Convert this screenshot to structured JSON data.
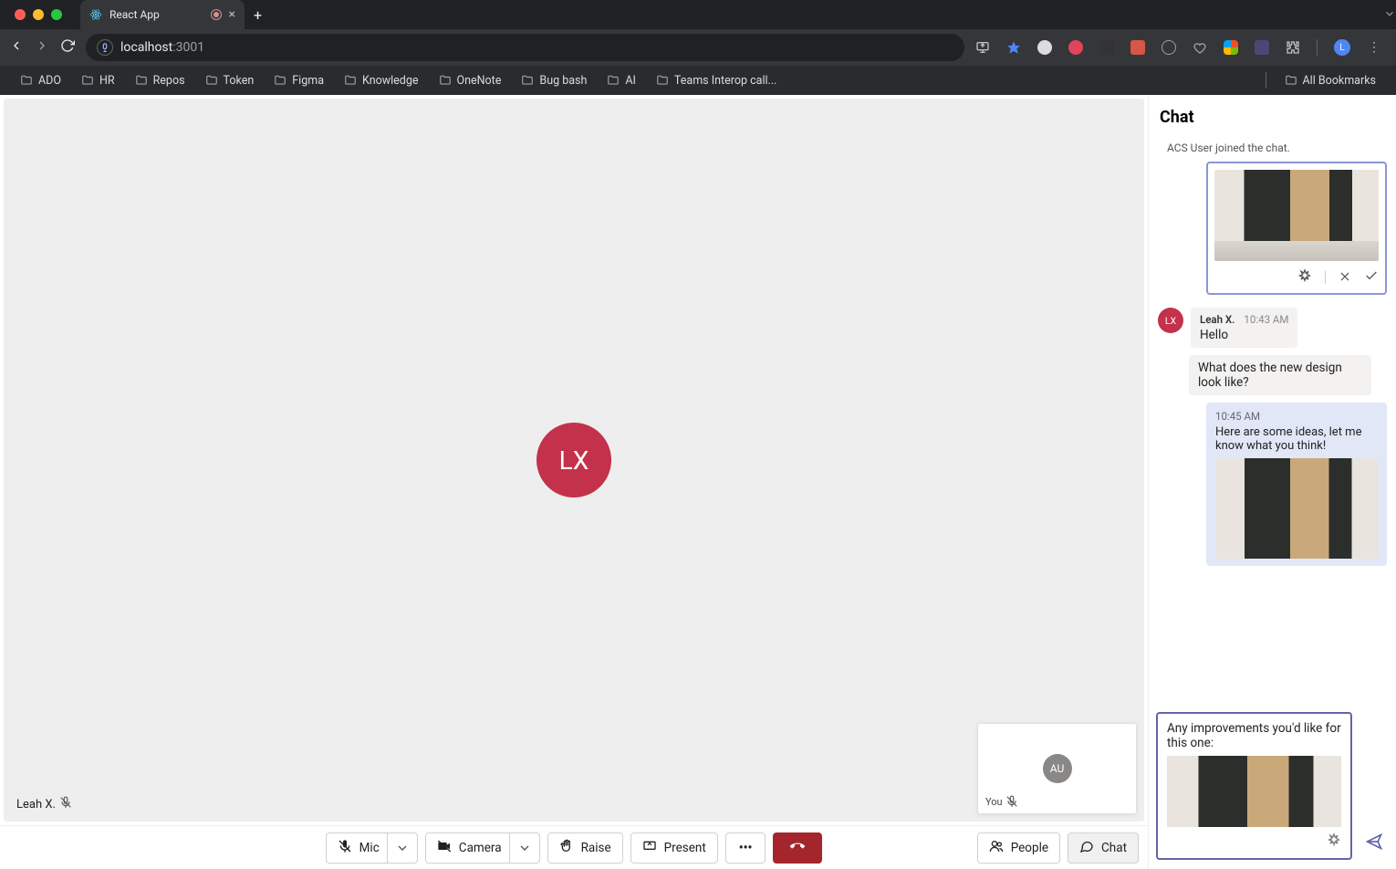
{
  "browser": {
    "tab_title": "React App",
    "url_host": "localhost",
    "url_port": ":3001",
    "profile_initial": "L",
    "bookmarks": [
      "ADO",
      "HR",
      "Repos",
      "Token",
      "Figma",
      "Knowledge",
      "OneNote",
      "Bug bash",
      "AI",
      "Teams Interop call..."
    ],
    "all_bookmarks": "All Bookmarks"
  },
  "call": {
    "main_avatar": "LX",
    "participant_name": "Leah X.",
    "pip_avatar": "AU",
    "pip_label": "You"
  },
  "toolbar": {
    "mic": "Mic",
    "camera": "Camera",
    "raise": "Raise",
    "present": "Present",
    "people": "People",
    "chat": "Chat"
  },
  "chat": {
    "title": "Chat",
    "system": "ACS User joined the chat.",
    "leah": {
      "name": "Leah X.",
      "time": "10:43 AM",
      "msg1": "Hello",
      "msg2": "What does the new design look like?"
    },
    "out": {
      "time": "10:45 AM",
      "msg": "Here are some ideas, let me know what you think!"
    },
    "composer": "Any improvements you'd like for this one:"
  }
}
